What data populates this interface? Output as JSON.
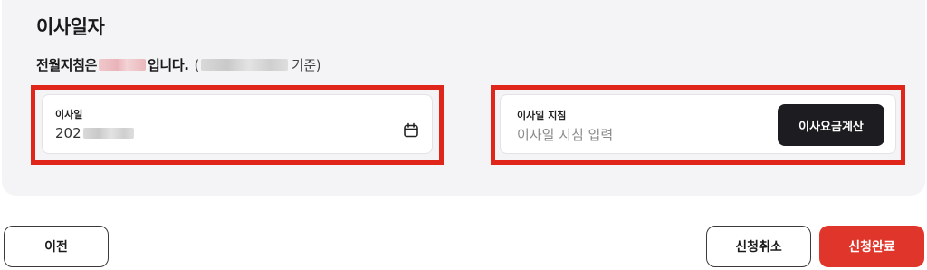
{
  "section": {
    "title": "이사일자"
  },
  "meter": {
    "prefix": "전월지침은",
    "suffix": "입니다.",
    "paren_open": "(",
    "basis": "기준)"
  },
  "move_date": {
    "label": "이사일",
    "value": "202"
  },
  "move_reading": {
    "label": "이사일 지침",
    "placeholder": "이사일 지침 입력",
    "calc_button": "이사요금계산"
  },
  "footer": {
    "prev_label": "이전",
    "cancel_label": "신청취소",
    "complete_label": "신청완료"
  },
  "colors": {
    "accent": "#e0352b",
    "highlight": "#e0261b",
    "dark_button": "#1d1d21"
  },
  "icons": {
    "date": "calendar-icon"
  }
}
